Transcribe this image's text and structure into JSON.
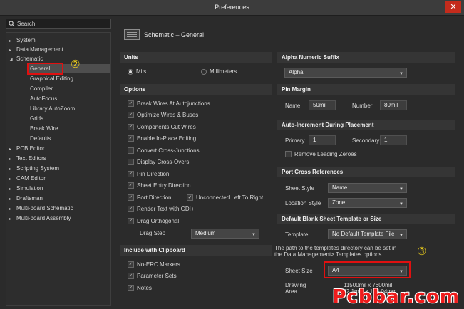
{
  "window": {
    "title": "Preferences",
    "close_icon": "close-icon",
    "accent": "#c42b1c"
  },
  "search": {
    "placeholder": "Search"
  },
  "tree": [
    {
      "label": "System",
      "arrow": "▸"
    },
    {
      "label": "Data Management",
      "arrow": "▸"
    },
    {
      "label": "Schematic",
      "arrow": "◢"
    },
    {
      "label": "General",
      "arrow": ""
    },
    {
      "label": "Graphical Editing",
      "arrow": ""
    },
    {
      "label": "Compiler",
      "arrow": ""
    },
    {
      "label": "AutoFocus",
      "arrow": ""
    },
    {
      "label": "Library AutoZoom",
      "arrow": ""
    },
    {
      "label": "Grids",
      "arrow": ""
    },
    {
      "label": "Break Wire",
      "arrow": ""
    },
    {
      "label": "Defaults",
      "arrow": ""
    },
    {
      "label": "PCB Editor",
      "arrow": "▸"
    },
    {
      "label": "Text Editors",
      "arrow": "▸"
    },
    {
      "label": "Scripting System",
      "arrow": "▸"
    },
    {
      "label": "CAM Editor",
      "arrow": "▸"
    },
    {
      "label": "Simulation",
      "arrow": "▸"
    },
    {
      "label": "Draftsman",
      "arrow": "▸"
    },
    {
      "label": "Multi-board Schematic",
      "arrow": "▸"
    },
    {
      "label": "Multi-board Assembly",
      "arrow": "▸"
    }
  ],
  "annotations": {
    "marker_2": "②",
    "marker_3": "③"
  },
  "header": {
    "title": "Schematic – General"
  },
  "units": {
    "section": "Units",
    "mils": "Mils",
    "millimeters": "Millimeters",
    "selected": "Mils"
  },
  "options": {
    "section": "Options",
    "items": [
      {
        "label": "Break Wires At Autojunctions",
        "checked": true
      },
      {
        "label": "Optimize Wires & Buses",
        "checked": true
      },
      {
        "label": "Components Cut Wires",
        "checked": true
      },
      {
        "label": "Enable In-Place Editing",
        "checked": true
      },
      {
        "label": "Convert Cross-Junctions",
        "checked": false
      },
      {
        "label": "Display Cross-Overs",
        "checked": false
      },
      {
        "label": "Pin Direction",
        "checked": true
      },
      {
        "label": "Sheet Entry Direction",
        "checked": true
      },
      {
        "label": "Port Direction",
        "checked": true
      },
      {
        "label": "Render Text with GDI+",
        "checked": true
      },
      {
        "label": "Drag Orthogonal",
        "checked": true
      }
    ],
    "unconnected": {
      "label": "Unconnected Left To Right",
      "checked": true
    },
    "drag_step_label": "Drag Step",
    "drag_step_value": "Medium"
  },
  "clipboard": {
    "section": "Include with Clipboard",
    "items": [
      {
        "label": "No-ERC Markers",
        "checked": true
      },
      {
        "label": "Parameter Sets",
        "checked": true
      },
      {
        "label": "Notes",
        "checked": true
      }
    ]
  },
  "alpha": {
    "section": "Alpha Numeric Suffix",
    "value": "Alpha"
  },
  "pin_margin": {
    "section": "Pin Margin",
    "name_label": "Name",
    "name_value": "50mil",
    "number_label": "Number",
    "number_value": "80mil"
  },
  "auto_increment": {
    "section": "Auto-Increment During Placement",
    "primary_label": "Primary",
    "primary_value": "1",
    "secondary_label": "Secondary",
    "secondary_value": "1",
    "remove_zeroes": "Remove Leading Zeroes",
    "remove_checked": false
  },
  "port_cross": {
    "section": "Port Cross References",
    "sheet_style_label": "Sheet Style",
    "sheet_style_value": "Name",
    "location_style_label": "Location Style",
    "location_style_value": "Zone"
  },
  "blank_sheet": {
    "section": "Default Blank Sheet Template or Size",
    "template_label": "Template",
    "template_value": "No Default Template File",
    "note_line1": "The path to the templates directory can be set in",
    "note_line2": "the Data Management> Templates options.",
    "sheet_size_label": "Sheet Size",
    "sheet_size_value": "A4",
    "drawing_area_label1": "Drawing",
    "drawing_area_label2": "Area",
    "drawing_area_value1": "11500mil x 7600mil",
    "drawing_area_value2": "292.1mm x 193.04mm"
  },
  "watermark": "Pcbbar.com",
  "colors": {
    "highlight_box": "#e01010",
    "marker": "#f2d21b",
    "watermark": "#ee1c1c"
  }
}
